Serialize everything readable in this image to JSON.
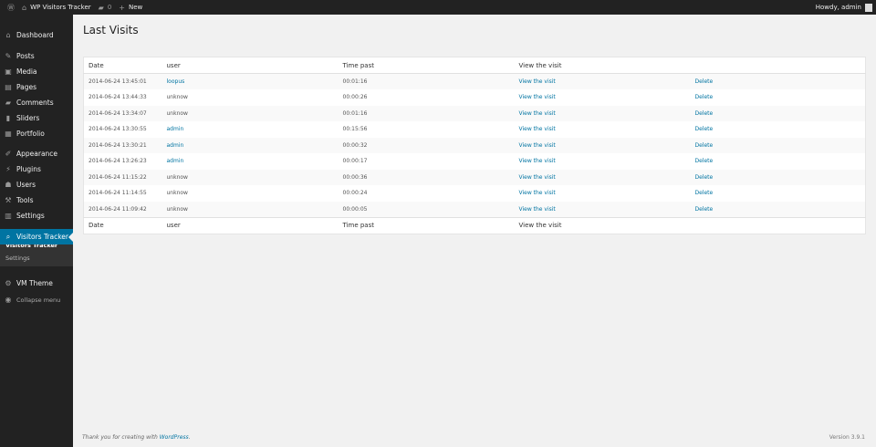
{
  "topbar": {
    "site_name": "WP Visitors Tracker",
    "comments_count": "0",
    "new_label": "New",
    "howdy": "Howdy, admin"
  },
  "sidebar": {
    "items": [
      {
        "label": "Dashboard",
        "icon": "dashboard-icon",
        "glyph": "⌂"
      },
      {
        "label": "Posts",
        "icon": "pin-icon",
        "glyph": "✎"
      },
      {
        "label": "Media",
        "icon": "media-icon",
        "glyph": "▣"
      },
      {
        "label": "Pages",
        "icon": "pages-icon",
        "glyph": "▤"
      },
      {
        "label": "Comments",
        "icon": "comment-icon",
        "glyph": "▰"
      },
      {
        "label": "Sliders",
        "icon": "sliders-icon",
        "glyph": "▮"
      },
      {
        "label": "Portfolio",
        "icon": "portfolio-icon",
        "glyph": "▦"
      },
      {
        "label": "Appearance",
        "icon": "brush-icon",
        "glyph": "✐"
      },
      {
        "label": "Plugins",
        "icon": "plugin-icon",
        "glyph": "⚡"
      },
      {
        "label": "Users",
        "icon": "user-icon",
        "glyph": "☗"
      },
      {
        "label": "Tools",
        "icon": "wrench-icon",
        "glyph": "⚒"
      },
      {
        "label": "Settings",
        "icon": "settings-icon",
        "glyph": "▥"
      },
      {
        "label": "Visitors Tracker",
        "icon": "search-icon",
        "glyph": "⌕"
      },
      {
        "label": "VM Theme",
        "icon": "gear-icon",
        "glyph": "⚙"
      },
      {
        "label": "Collapse menu",
        "icon": "collapse-icon",
        "glyph": "◉"
      }
    ],
    "submenu": [
      "Visitors Tracker",
      "Settings"
    ]
  },
  "page_title": "Last Visits",
  "table": {
    "headers": [
      "Date",
      "user",
      "Time past",
      "View the visit",
      ""
    ],
    "rows": [
      {
        "date": "2014-06-24 13:45:01",
        "user": "loopus",
        "user_link": true,
        "time": "00:01:16",
        "view": "View the visit",
        "delete": "Delete"
      },
      {
        "date": "2014-06-24 13:44:33",
        "user": "unknow",
        "user_link": false,
        "time": "00:00:26",
        "view": "View the visit",
        "delete": "Delete"
      },
      {
        "date": "2014-06-24 13:34:07",
        "user": "unknow",
        "user_link": false,
        "time": "00:01:16",
        "view": "View the visit",
        "delete": "Delete"
      },
      {
        "date": "2014-06-24 13:30:55",
        "user": "admin",
        "user_link": true,
        "time": "00:15:56",
        "view": "View the visit",
        "delete": "Delete"
      },
      {
        "date": "2014-06-24 13:30:21",
        "user": "admin",
        "user_link": true,
        "time": "00:00:32",
        "view": "View the visit",
        "delete": "Delete"
      },
      {
        "date": "2014-06-24 13:26:23",
        "user": "admin",
        "user_link": true,
        "time": "00:00:17",
        "view": "View the visit",
        "delete": "Delete"
      },
      {
        "date": "2014-06-24 11:15:22",
        "user": "unknow",
        "user_link": false,
        "time": "00:00:36",
        "view": "View the visit",
        "delete": "Delete"
      },
      {
        "date": "2014-06-24 11:14:55",
        "user": "unknow",
        "user_link": false,
        "time": "00:00:24",
        "view": "View the visit",
        "delete": "Delete"
      },
      {
        "date": "2014-06-24 11:09:42",
        "user": "unknow",
        "user_link": false,
        "time": "00:00:05",
        "view": "View the visit",
        "delete": "Delete"
      }
    ]
  },
  "footer": {
    "text": "Thank you for creating with ",
    "link": "WordPress",
    "period": ".",
    "version": "Version 3.9.1"
  }
}
